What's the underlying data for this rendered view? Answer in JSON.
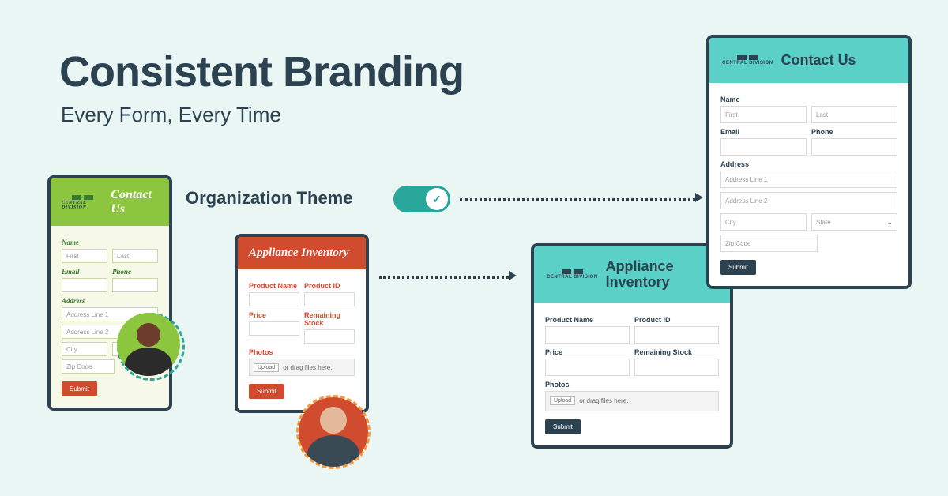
{
  "headline": "Consistent Branding",
  "subhead": "Every Form, Every Time",
  "toggle_label": "Organization Theme",
  "logo_text": "CENTRAL DIVISION",
  "contact_form": {
    "title": "Contact Us",
    "name_label": "Name",
    "first_ph": "First",
    "last_ph": "Last",
    "email_label": "Email",
    "phone_label": "Phone",
    "address_label": "Address",
    "addr1_ph": "Address Line 1",
    "addr2_ph": "Address Line 2",
    "city_ph": "City",
    "state_ph": "State",
    "zip_ph": "Zip Code",
    "submit": "Submit"
  },
  "inventory_form": {
    "title": "Appliance Inventory",
    "product_name_label": "Product Name",
    "product_id_label": "Product ID",
    "price_label": "Price",
    "stock_label": "Remaining Stock",
    "photos_label": "Photos",
    "upload_btn": "Upload",
    "upload_hint": "or drag files here.",
    "submit": "Submit"
  }
}
